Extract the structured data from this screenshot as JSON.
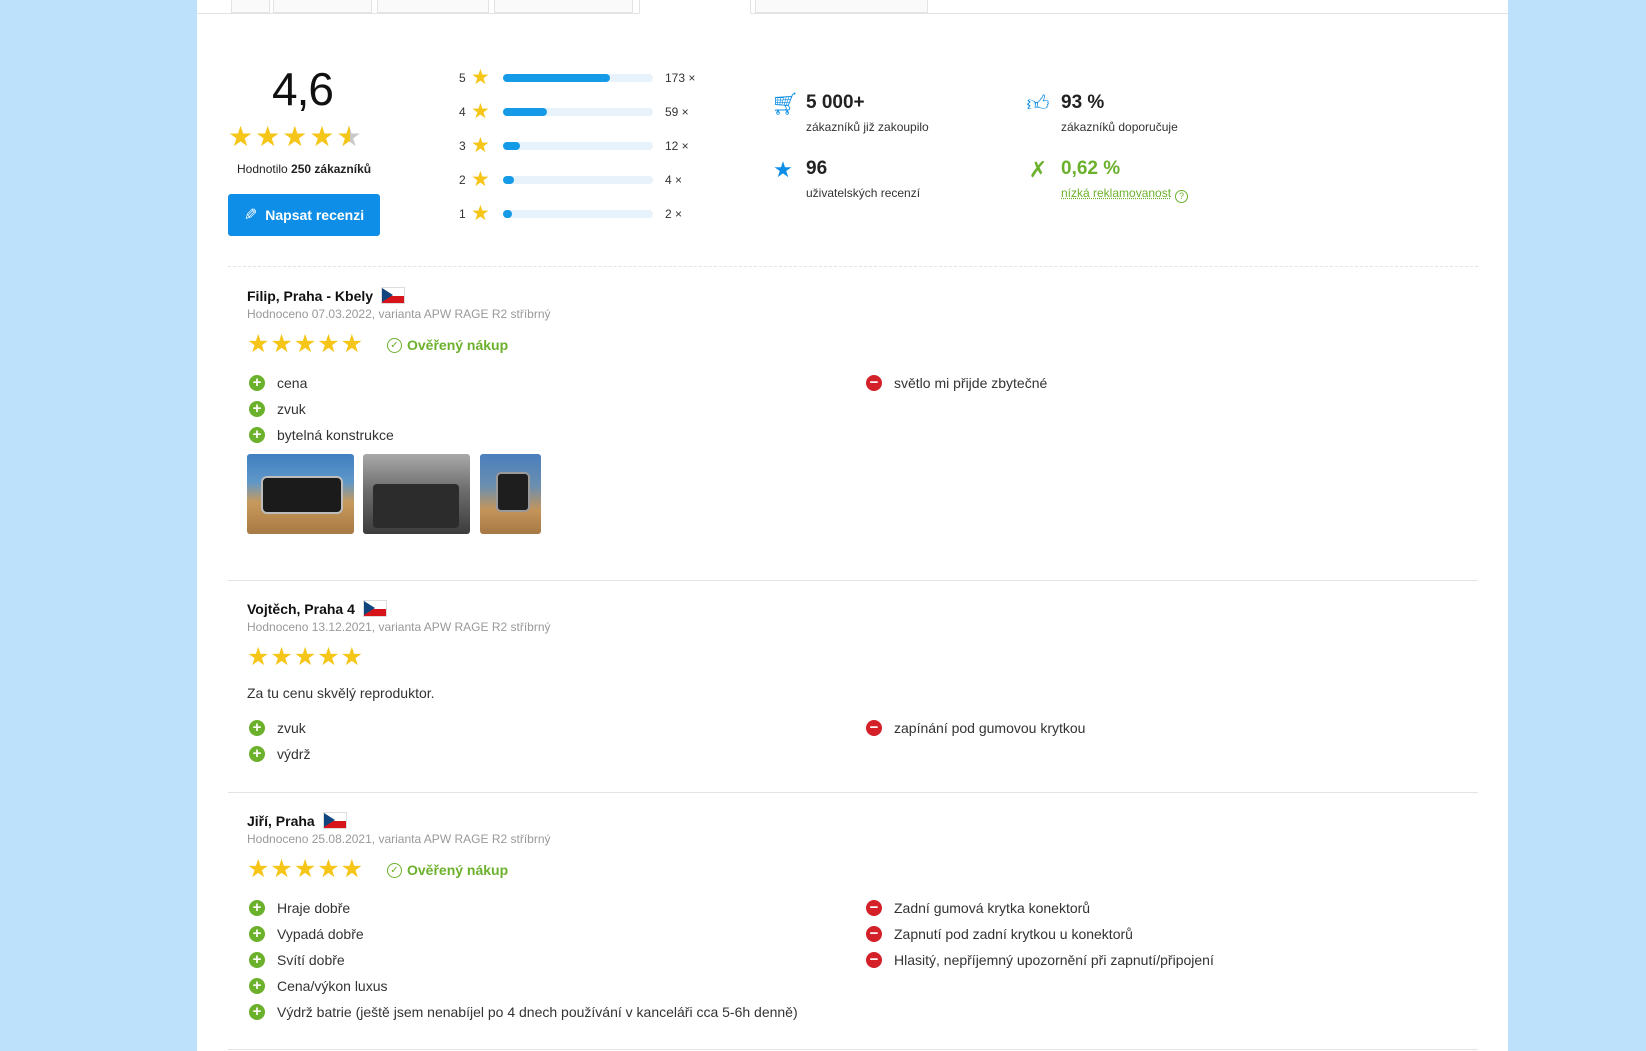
{
  "summary": {
    "average": "4,6",
    "average_value": 4.6,
    "rated_prefix": "Hodnotilo",
    "rated_count": "250 zákazníků",
    "write_button": "Napsat recenzi",
    "distribution": [
      {
        "stars": "5",
        "count": "173 ×",
        "fraction": 0.71
      },
      {
        "stars": "4",
        "count": "59 ×",
        "fraction": 0.29
      },
      {
        "stars": "3",
        "count": "12 ×",
        "fraction": 0.11
      },
      {
        "stars": "2",
        "count": "4 ×",
        "fraction": 0.07
      },
      {
        "stars": "1",
        "count": "2 ×",
        "fraction": 0.06
      }
    ],
    "stats": {
      "bought": {
        "value": "5 000+",
        "label": "zákazníků již zakoupilo",
        "icon": "cart-icon"
      },
      "recommend": {
        "value": "93 %",
        "label": "zákazníků doporučuje",
        "icon": "thumbs-up-icon"
      },
      "reviews": {
        "value": "96",
        "label": "uživatelských recenzí",
        "icon": "star-icon"
      },
      "complaints": {
        "value": "0,62 %",
        "label": "nízká reklamovanost",
        "icon": "tools-icon"
      }
    }
  },
  "reviews": [
    {
      "name": "Filip, Praha - Kbely",
      "meta": "Hodnoceno 07.03.2022, varianta APW RAGE R2 stříbrný",
      "rating": 5,
      "verified": "Ověřený nákup",
      "text": "",
      "pros": [
        "cena",
        "zvuk",
        "bytelná konstrukce"
      ],
      "cons": [
        "světlo mi přijde zbytečné"
      ]
    },
    {
      "name": "Vojtěch, Praha 4",
      "meta": "Hodnoceno 13.12.2021, varianta APW RAGE R2 stříbrný",
      "rating": 5,
      "verified": "",
      "text": "Za tu cenu skvělý reproduktor.",
      "pros": [
        "zvuk",
        "výdrž"
      ],
      "cons": [
        "zapínání pod gumovou krytkou"
      ]
    },
    {
      "name": "Jiří, Praha",
      "meta": "Hodnoceno 25.08.2021, varianta APW RAGE R2 stříbrný",
      "rating": 5,
      "verified": "Ověřený nákup",
      "text": "",
      "pros": [
        "Hraje dobře",
        "Vypadá dobře",
        "Svítí dobře",
        "Cena/výkon luxus",
        "Výdrž batrie (ještě jsem nenabíjel po 4 dnech používání v kanceláři cca 5-6h denně)"
      ],
      "cons": [
        "Zadní gumová krytka konektorů",
        "Zapnutí pod zadní krytkou u konektorů",
        "Hlasitý, nepříjemný upozornění při zapnutí/připojení"
      ]
    }
  ],
  "colors": {
    "accent": "#0e8ee6",
    "star": "#f5c518",
    "pro": "#6cb12c",
    "con": "#d32029",
    "background": "#bde1fb"
  }
}
